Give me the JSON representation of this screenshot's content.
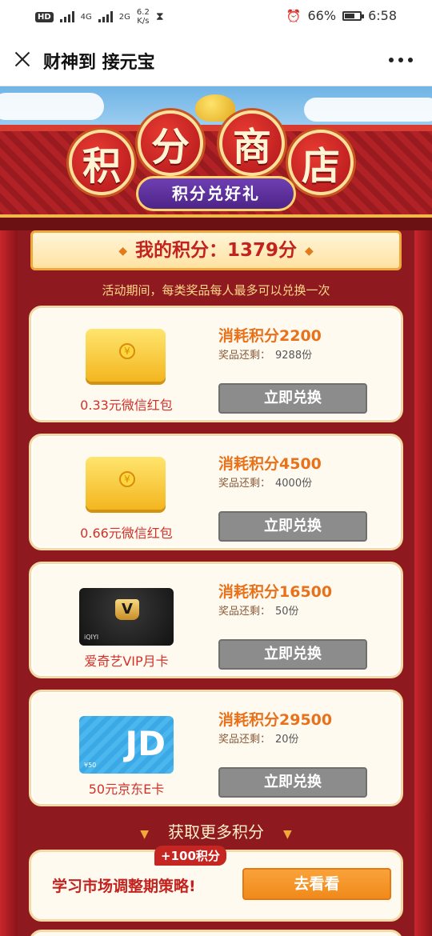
{
  "status_bar": {
    "hd": "HD",
    "net_type_1": "4G",
    "net_type_2": "2G",
    "speed": "6.2",
    "speed_unit": "K/s",
    "battery": "66%",
    "time": "6:58"
  },
  "header": {
    "title": "财神到 接元宝"
  },
  "banner": {
    "chars": [
      "积",
      "分",
      "商",
      "店"
    ],
    "subtitle": "积分兑好礼"
  },
  "points": {
    "label": "我的积分：1379分"
  },
  "rule": "活动期间，每类奖品每人最多可以兑换一次",
  "remain_label": "奖品还剩：",
  "redeem_label": "立即兑换",
  "items": [
    {
      "name": "0.33元微信红包",
      "cost": "消耗积分2200",
      "remain": "9288份"
    },
    {
      "name": "0.66元微信红包",
      "cost": "消耗积分4500",
      "remain": "4000份"
    },
    {
      "name": "爱奇艺VIP月卡",
      "cost": "消耗积分16500",
      "remain": "50份"
    },
    {
      "name": "50元京东E卡",
      "cost": "消耗积分29500",
      "remain": "20份"
    }
  ],
  "more": {
    "header": "获取更多积分"
  },
  "task": {
    "title": "学习市场调整期策略!",
    "badge": "+100积分",
    "button": "去看看"
  },
  "colors": {
    "page_bg": "#8e1a1f",
    "accent_orange": "#e8711b",
    "accent_red": "#c3231f",
    "button_gray": "#8c8c8c",
    "button_orange": "#f08a1a"
  },
  "icons": {
    "close": "close-icon",
    "more": "more-icon",
    "alarm": "alarm-icon",
    "hourglass": "hourglass-icon"
  }
}
